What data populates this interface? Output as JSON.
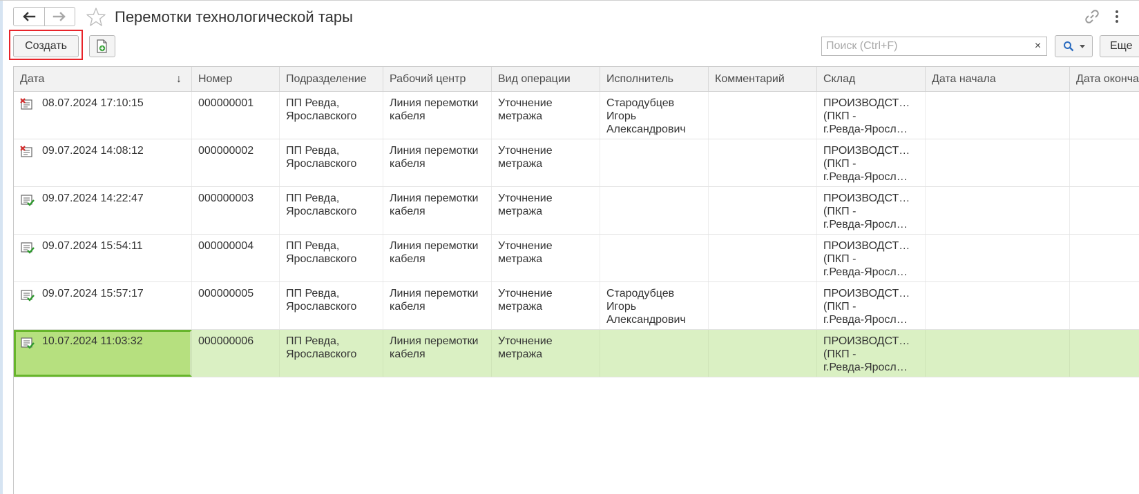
{
  "window": {
    "title": "Перемотки технологической тары"
  },
  "toolbar": {
    "create_label": "Создать",
    "search_placeholder": "Поиск (Ctrl+F)",
    "clear_label": "×",
    "more_label": "Еще"
  },
  "table": {
    "columns": [
      {
        "label": "Дата",
        "sorted": "desc"
      },
      {
        "label": "Номер"
      },
      {
        "label": "Подразделение"
      },
      {
        "label": "Рабочий центр"
      },
      {
        "label": "Вид операции"
      },
      {
        "label": "Исполнитель"
      },
      {
        "label": "Комментарий"
      },
      {
        "label": "Склад"
      },
      {
        "label": "Дата начала"
      },
      {
        "label": "Дата окончания"
      }
    ],
    "sort_indicator": "↓",
    "rows": [
      {
        "status": "deleted",
        "date": "08.07.2024 17:10:15",
        "number": "000000001",
        "division": [
          "ПП Ревда,",
          "Ярославского"
        ],
        "work_center": [
          "Линия перемотки",
          "кабеля"
        ],
        "operation": [
          "Уточнение",
          "метража"
        ],
        "executor": [
          "Стародубцев",
          "Игорь",
          "Александрович"
        ],
        "comment": "",
        "warehouse": [
          "ПРОИЗВОДСТ…",
          "(ПКП -",
          "г.Ревда-Яросл…"
        ],
        "start_date": "",
        "end_date": ""
      },
      {
        "status": "deleted",
        "date": "09.07.2024 14:08:12",
        "number": "000000002",
        "division": [
          "ПП Ревда,",
          "Ярославского"
        ],
        "work_center": [
          "Линия перемотки",
          "кабеля"
        ],
        "operation": [
          "Уточнение",
          "метража"
        ],
        "executor": [
          "",
          "",
          ""
        ],
        "comment": "",
        "warehouse": [
          "ПРОИЗВОДСТ…",
          "(ПКП -",
          "г.Ревда-Яросл…"
        ],
        "start_date": "",
        "end_date": ""
      },
      {
        "status": "posted",
        "date": "09.07.2024 14:22:47",
        "number": "000000003",
        "division": [
          "ПП Ревда,",
          "Ярославского"
        ],
        "work_center": [
          "Линия перемотки",
          "кабеля"
        ],
        "operation": [
          "Уточнение",
          "метража"
        ],
        "executor": [
          "",
          "",
          ""
        ],
        "comment": "",
        "warehouse": [
          "ПРОИЗВОДСТ…",
          "(ПКП -",
          "г.Ревда-Яросл…"
        ],
        "start_date": "",
        "end_date": ""
      },
      {
        "status": "posted",
        "date": "09.07.2024 15:54:11",
        "number": "000000004",
        "division": [
          "ПП Ревда,",
          "Ярославского"
        ],
        "work_center": [
          "Линия перемотки",
          "кабеля"
        ],
        "operation": [
          "Уточнение",
          "метража"
        ],
        "executor": [
          "",
          "",
          ""
        ],
        "comment": "",
        "warehouse": [
          "ПРОИЗВОДСТ…",
          "(ПКП -",
          "г.Ревда-Яросл…"
        ],
        "start_date": "",
        "end_date": ""
      },
      {
        "status": "posted",
        "date": "09.07.2024 15:57:17",
        "number": "000000005",
        "division": [
          "ПП Ревда,",
          "Ярославского"
        ],
        "work_center": [
          "Линия перемотки",
          "кабеля"
        ],
        "operation": [
          "Уточнение",
          "метража"
        ],
        "executor": [
          "Стародубцев",
          "Игорь",
          "Александрович"
        ],
        "comment": "",
        "warehouse": [
          "ПРОИЗВОДСТ…",
          "(ПКП -",
          "г.Ревда-Яросл…"
        ],
        "start_date": "",
        "end_date": ""
      },
      {
        "status": "posted",
        "selected": true,
        "date": "10.07.2024 11:03:32",
        "number": "000000006",
        "division": [
          "ПП Ревда,",
          "Ярославского"
        ],
        "work_center": [
          "Линия перемотки",
          "кабеля"
        ],
        "operation": [
          "Уточнение",
          "метража"
        ],
        "executor": [
          "",
          "",
          ""
        ],
        "comment": "",
        "warehouse": [
          "ПРОИЗВОДСТ…",
          "(ПКП -",
          "г.Ревда-Яросл…"
        ],
        "start_date": "",
        "end_date": ""
      }
    ]
  },
  "icons": {
    "back": "arrow-left-icon",
    "forward": "arrow-right-icon",
    "favorite": "star-icon",
    "link": "link-icon",
    "more": "vertical-dots-icon",
    "copy": "add-document-icon",
    "search": "magnifier-icon",
    "deleted_status": "document-deleted-icon",
    "posted_status": "document-posted-icon"
  },
  "colors": {
    "selected_row": "#daf0c3",
    "current_cell": "#b6e07f",
    "current_cell_border": "#67b52b",
    "create_highlight": "#e8242a",
    "deleted_mark": "#d52b2b",
    "posted_mark": "#2e9b2e"
  }
}
